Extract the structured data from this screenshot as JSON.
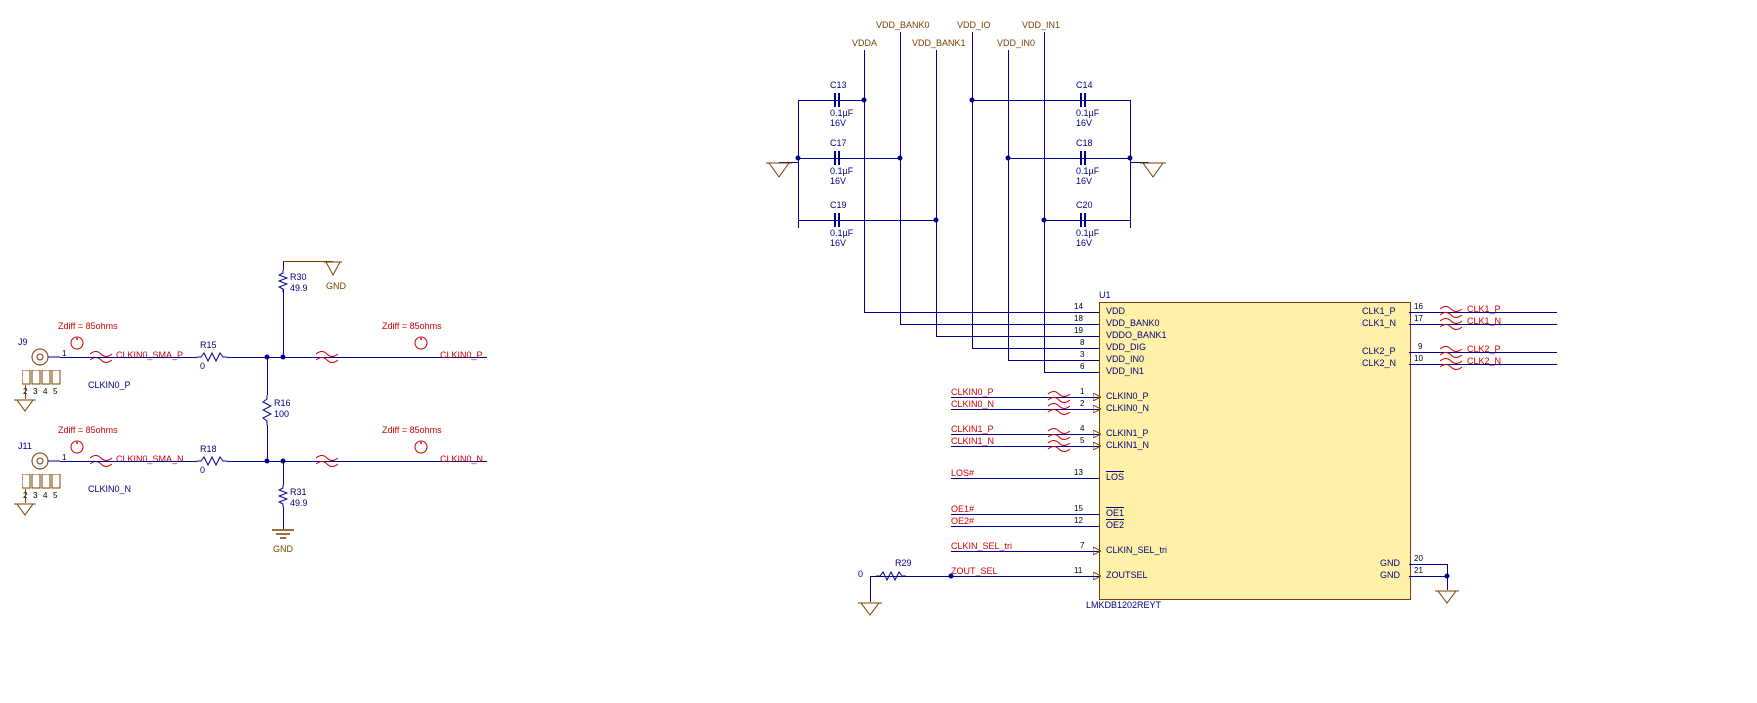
{
  "colors": {
    "wire": "#00008f",
    "brown": "#7a3f00",
    "red": "#d00000",
    "ic_fill": "#fff1a8"
  },
  "power_rails": {
    "top_left": [
      "VDDA",
      "VDD_BANK1",
      "VDD_IN0"
    ],
    "top_right": [
      "VDD_BANK0",
      "VDD_IO",
      "VDD_IN1"
    ]
  },
  "capacitors": {
    "C13": {
      "ref": "C13",
      "value": "0.1µF",
      "voltage": "16V"
    },
    "C14": {
      "ref": "C14",
      "value": "0.1µF",
      "voltage": "16V"
    },
    "C17": {
      "ref": "C17",
      "value": "0.1µF",
      "voltage": "16V"
    },
    "C18": {
      "ref": "C18",
      "value": "0.1µF",
      "voltage": "16V"
    },
    "C19": {
      "ref": "C19",
      "value": "0.1µF",
      "voltage": "16V"
    },
    "C20": {
      "ref": "C20",
      "value": "0.1µF",
      "voltage": "16V"
    }
  },
  "resistors": {
    "R30": {
      "ref": "R30",
      "value": "49.9"
    },
    "R31": {
      "ref": "R31",
      "value": "49.9"
    },
    "R15": {
      "ref": "R15",
      "value": "0"
    },
    "R16": {
      "ref": "R16",
      "value": "100"
    },
    "R18": {
      "ref": "R18",
      "value": "0"
    },
    "R29": {
      "ref": "R29",
      "value": "0"
    }
  },
  "gnd_labels": {
    "gnd": "GND"
  },
  "annotations": {
    "zdiff": "Zdiff = 85ohms"
  },
  "connectors": {
    "J9": {
      "ref": "J9",
      "net_name": "CLKIN0_P",
      "signal": "CLKIN0_SMA_P",
      "pins": [
        "1",
        "2",
        "3",
        "4",
        "5"
      ]
    },
    "J11": {
      "ref": "J11",
      "net_name": "CLKIN0_N",
      "signal": "CLKIN0_SMA_N",
      "pins": [
        "1",
        "2",
        "3",
        "4",
        "5"
      ]
    }
  },
  "nets": {
    "clk_out": {
      "CLK1_P": "CLK1_P",
      "CLK1_N": "CLK1_N",
      "CLK2_P": "CLK2_P",
      "CLK2_N": "CLK2_N"
    },
    "clk_in_left": {
      "CLKIN0_P": "CLKIN0_P",
      "CLKIN0_N": "CLKIN0_N"
    },
    "ic_left_nets": {
      "CLKIN0_P": "CLKIN0_P",
      "CLKIN0_N": "CLKIN0_N",
      "CLKIN1_P": "CLKIN1_P",
      "CLKIN1_N": "CLKIN1_N",
      "LOS": "LOS#",
      "OE1": "OE1#",
      "OE2": "OE2#",
      "CLKIN_SEL": "CLKIN_SEL_tri",
      "ZOUT_SEL": "ZOUT_SEL"
    }
  },
  "ic": {
    "ref": "U1",
    "part": "LMKDB1202REYT",
    "pins_left": [
      {
        "num": "14",
        "name": "VDD"
      },
      {
        "num": "18",
        "name": "VDD_BANK0"
      },
      {
        "num": "19",
        "name": "VDDO_BANK1"
      },
      {
        "num": "8",
        "name": "VDD_DIG"
      },
      {
        "num": "3",
        "name": "VDD_IN0"
      },
      {
        "num": "6",
        "name": "VDD_IN1"
      },
      {
        "num": "1",
        "name": "CLKIN0_P"
      },
      {
        "num": "2",
        "name": "CLKIN0_N"
      },
      {
        "num": "4",
        "name": "CLKIN1_P"
      },
      {
        "num": "5",
        "name": "CLKIN1_N"
      },
      {
        "num": "13",
        "name": "LOS",
        "ov": true
      },
      {
        "num": "15",
        "name": "OE1",
        "ov": true
      },
      {
        "num": "12",
        "name": "OE2",
        "ov": true
      },
      {
        "num": "7",
        "name": "CLKIN_SEL_tri"
      },
      {
        "num": "11",
        "name": "ZOUTSEL"
      }
    ],
    "pins_right": [
      {
        "num": "16",
        "name": "CLK1_P"
      },
      {
        "num": "17",
        "name": "CLK1_N"
      },
      {
        "num": "9",
        "name": "CLK2_P"
      },
      {
        "num": "10",
        "name": "CLK2_N"
      },
      {
        "num": "20",
        "name": "GND"
      },
      {
        "num": "21",
        "name": "GND"
      }
    ]
  },
  "chart_data": null
}
